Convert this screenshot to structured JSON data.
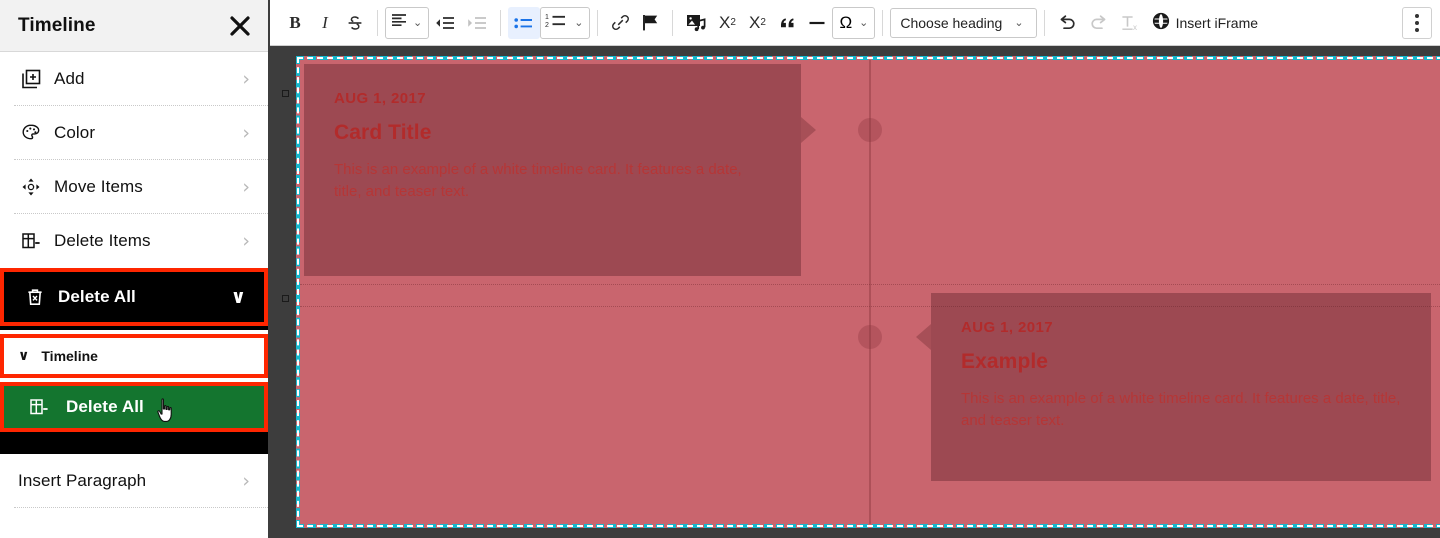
{
  "sidebar": {
    "title": "Timeline",
    "close_icon": "close-x-icon",
    "items": [
      {
        "label": "Add",
        "icon": "add-square-icon",
        "chevron": "›"
      },
      {
        "label": "Color",
        "icon": "palette-icon",
        "chevron": "›"
      },
      {
        "label": "Move Items",
        "icon": "move-arrows-icon",
        "chevron": "›"
      },
      {
        "label": "Delete Items",
        "icon": "delete-items-icon",
        "chevron": "›"
      }
    ],
    "delete_all": {
      "label": "Delete All",
      "icon": "trash-icon",
      "chevron": "∨",
      "select_value": "Timeline",
      "select_caret": "∨",
      "confirm_label": "Delete All",
      "confirm_icon": "delete-items-icon",
      "highlight_color": "#fe2600",
      "confirm_color": "#14752f"
    },
    "insert_paragraph": {
      "label": "Insert Paragraph",
      "chevron": "›"
    }
  },
  "toolbar": {
    "bold": "B",
    "italic": "I",
    "strikethrough": "S",
    "align_label": "align-left-icon",
    "align_caret": "⌄",
    "outdent": "outdent-icon",
    "indent": "indent-icon",
    "bullet_list": "bullet-list-icon",
    "numbered_list": "numbered-list-icon",
    "numbered_caret": "⌄",
    "link": "link-icon",
    "flag": "flag-icon",
    "media": "media-image-icon",
    "superscript": "X",
    "superscript_sup": "2",
    "subscript": "X",
    "subscript_sub": "2",
    "blockquote": "“",
    "horizontal_rule": "—",
    "special_char": "Ω",
    "special_caret": "⌄",
    "heading_label": "Choose heading",
    "heading_caret": "⌄",
    "undo": "undo-icon",
    "redo": "redo-icon",
    "remove_format": "remove-format-icon",
    "insert_iframe_label": "Insert iFrame",
    "insert_iframe_icon": "globe-icon",
    "kebab": "more-options-icon",
    "accent_active": "#1a73e8",
    "accent_active_bg": "#e8f0fe"
  },
  "canvas": {
    "background_color": "#c9656e",
    "selection_color": "#17b7cc",
    "cards": [
      {
        "date": "AUG 1, 2017",
        "title": "Card Title",
        "teaser": "This is an example of a white timeline card. It features a date, title, and teaser text.",
        "side": "left"
      },
      {
        "date": "AUG 1, 2017",
        "title": "Example",
        "teaser": "This is an example of a white timeline card. It features a date, title, and teaser text.",
        "side": "right"
      }
    ]
  }
}
